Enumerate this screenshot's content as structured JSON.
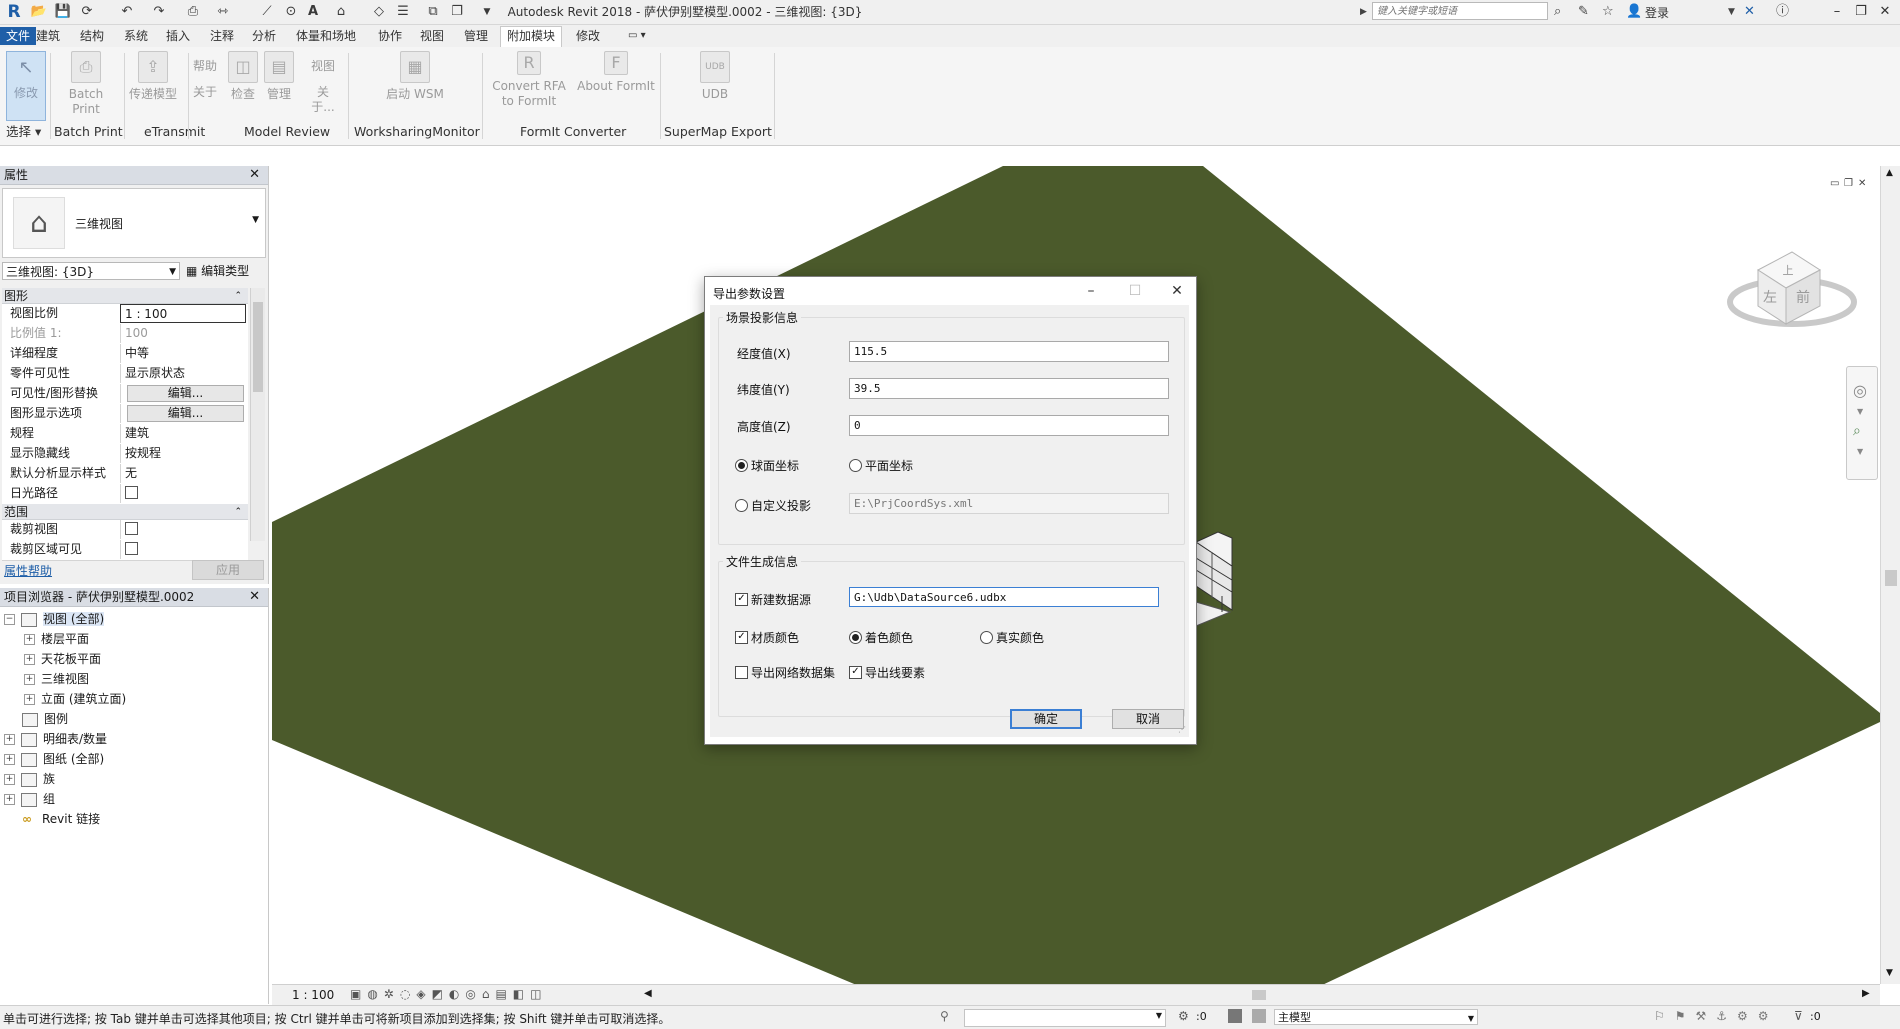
{
  "window": {
    "title": "Autodesk Revit 2018 -    萨伏伊别墅模型.0002 - 三维视图: {3D}",
    "search_placeholder": "键入关键字或短语",
    "signin": "登录",
    "logo": "R"
  },
  "menu_tabs": [
    "文件",
    "建筑",
    "结构",
    "系统",
    "插入",
    "注释",
    "分析",
    "体量和场地",
    "协作",
    "视图",
    "管理",
    "附加模块",
    "修改"
  ],
  "active_tab": "附加模块",
  "ribbon": {
    "modify": "修改",
    "select": "选择",
    "buttons": [
      {
        "label": "Batch Print",
        "icon": "printer-icon"
      },
      {
        "label": "传递模型",
        "icon": "transmit-icon"
      },
      {
        "label": "帮助",
        "sub": "关于",
        "icon": "help-icon"
      },
      {
        "label": "检查",
        "icon": "check-icon"
      },
      {
        "label": "管理",
        "icon": "manage-icon"
      },
      {
        "label": "视图",
        "sub": "关于...",
        "icon": "view-icon"
      },
      {
        "label": "启动 WSM",
        "icon": "wsm-icon"
      },
      {
        "label": "Convert RFA",
        "sub": "to FormIt",
        "icon": "revit-icon"
      },
      {
        "label": "About FormIt",
        "icon": "formit-icon"
      },
      {
        "label": "UDB",
        "icon": "udb-icon"
      }
    ],
    "panels": [
      "选择",
      "Batch Print",
      "eTransmit",
      "Model Review",
      "WorksharingMonitor",
      "FormIt Converter",
      "SuperMap Export"
    ]
  },
  "properties": {
    "title": "属性",
    "type_name": "三维视图",
    "view_selector": "三维视图: {3D}",
    "edit_type": "编辑类型",
    "group_graphics": "图形",
    "rows_graphics": [
      {
        "k": "视图比例",
        "v": "1 : 100"
      },
      {
        "k": "比例值 1:",
        "v": "100"
      },
      {
        "k": "详细程度",
        "v": "中等"
      },
      {
        "k": "零件可见性",
        "v": "显示原状态"
      },
      {
        "k": "可见性/图形替换",
        "v": "编辑..."
      },
      {
        "k": "图形显示选项",
        "v": "编辑..."
      },
      {
        "k": "规程",
        "v": "建筑"
      },
      {
        "k": "显示隐藏线",
        "v": "按规程"
      },
      {
        "k": "默认分析显示样式",
        "v": "无"
      },
      {
        "k": "日光路径",
        "v": ""
      }
    ],
    "group_extents": "范围",
    "rows_extents": [
      {
        "k": "裁剪视图",
        "v": ""
      },
      {
        "k": "裁剪区域可见",
        "v": ""
      }
    ],
    "help": "属性帮助",
    "apply": "应用"
  },
  "browser": {
    "title": "项目浏览器 - 萨伏伊别墅模型.0002",
    "nodes": [
      "视图 (全部)",
      "楼层平面",
      "天花板平面",
      "三维视图",
      "立面 (建筑立面)",
      "图例",
      "明细表/数量",
      "图纸 (全部)",
      "族",
      "组",
      "Revit 链接"
    ]
  },
  "viewcube": {
    "top": "上",
    "left": "左",
    "front": "前"
  },
  "view_control": {
    "scale": "1 : 100"
  },
  "status": {
    "hint": "单击可进行选择; 按 Tab 键并单击可选择其他项目; 按 Ctrl 键并单击可将新项目添加到选择集; 按 Shift 键并单击可取消选择。",
    "sel_count": ":0",
    "model": "主模型",
    "filter_count": ":0"
  },
  "dialog": {
    "title": "导出参数设置",
    "group_projection": "场景投影信息",
    "lon_label": "经度值(X)",
    "lon_value": "115.5",
    "lat_label": "纬度值(Y)",
    "lat_value": "39.5",
    "alt_label": "高度值(Z)",
    "alt_value": "0",
    "radio_spherical": "球面坐标",
    "radio_planar": "平面坐标",
    "radio_custom": "自定义投影",
    "custom_path": "E:\\PrjCoordSys.xml",
    "group_file": "文件生成信息",
    "new_datasource": "新建数据源",
    "datasource_path": "G:\\Udb\\DataSource6.udbx",
    "material_color": "材质颜色",
    "shading_color": "着色颜色",
    "real_color": "真实颜色",
    "export_network": "导出网络数据集",
    "export_lines": "导出线要素",
    "ok": "确定",
    "cancel": "取消"
  },
  "colors": {
    "ground": "#4b5a2b",
    "accent": "#1f5fa8"
  }
}
